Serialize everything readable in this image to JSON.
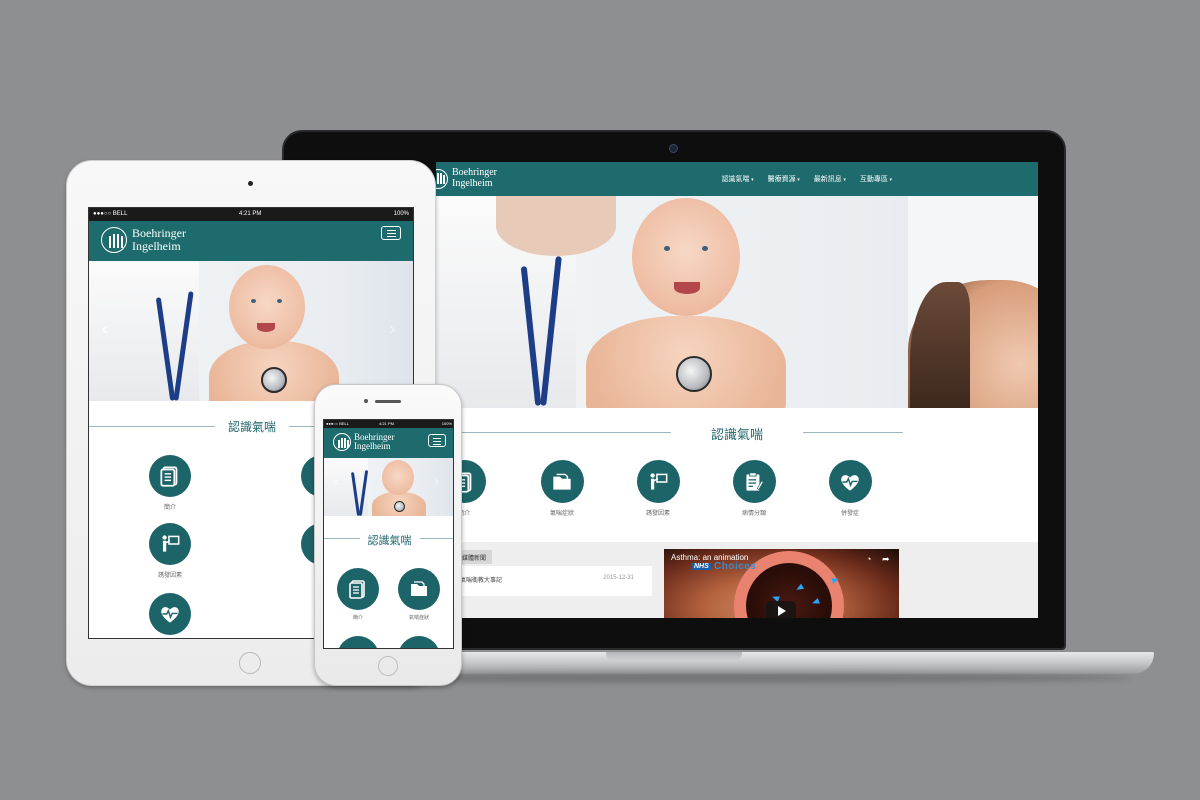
{
  "brand": {
    "line1": "Boehringer",
    "line2": "Ingelheim"
  },
  "colors": {
    "primary": "#1e6b6e",
    "icon_circle": "#1c6468",
    "backdrop": "#8e8f91"
  },
  "laptop": {
    "nav": {
      "items": [
        "認識氣喘",
        "醫療資源",
        "最新訊息",
        "互動專區"
      ]
    },
    "section_title": "認識氣喘",
    "icons": [
      {
        "label": "簡介",
        "icon": "document-icon"
      },
      {
        "label": "氣喘症狀",
        "icon": "folder-icon"
      },
      {
        "label": "誘發因素",
        "icon": "presentation-icon"
      },
      {
        "label": "病情分類",
        "icon": "clipboard-icon"
      },
      {
        "label": "併發症",
        "icon": "heart-pulse-icon"
      }
    ],
    "news": {
      "tab": "媒體新聞",
      "title": "氣喘衛教大事記",
      "date": "2015-12-31"
    },
    "video": {
      "title": "Asthma: an animation",
      "brand_nhs": "NHS",
      "brand_choices": "Choices"
    }
  },
  "tablet": {
    "status": {
      "carrier": "●●●○○ BELL",
      "time": "4:21 PM",
      "battery": "100%"
    },
    "section_title": "認識氣喘",
    "icons": [
      {
        "label": "簡介",
        "icon": "document-icon"
      },
      {
        "label": "誘發因素",
        "icon": "presentation-icon"
      },
      {
        "label": "",
        "icon": "heart-pulse-icon"
      }
    ]
  },
  "phone": {
    "status": {
      "carrier": "●●●○○ BELL",
      "time": "4:21 PM",
      "battery": "100%"
    },
    "section_title": "認識氣喘",
    "icons": [
      {
        "label": "簡介",
        "icon": "document-icon"
      },
      {
        "label": "氣喘症狀",
        "icon": "folder-icon"
      }
    ]
  }
}
